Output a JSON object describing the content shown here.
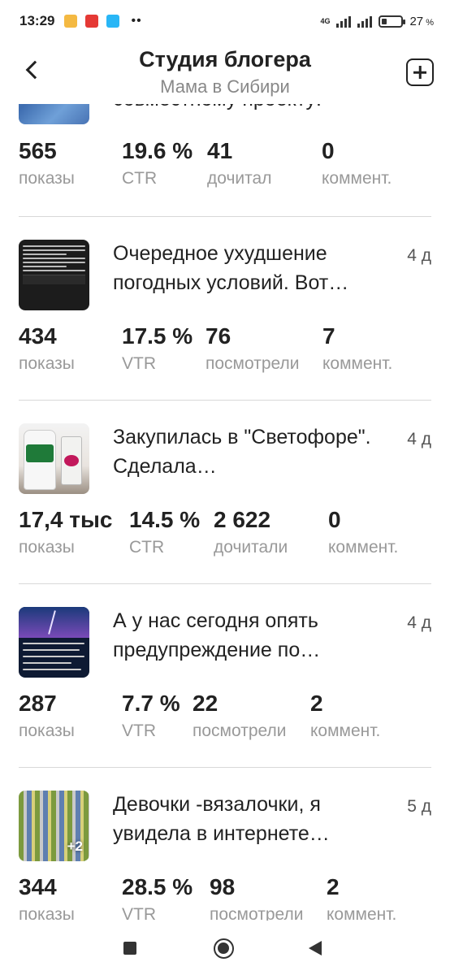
{
  "status_bar": {
    "time": "13:29",
    "network": "4G",
    "battery": "27"
  },
  "header": {
    "title": "Студия блогера",
    "subtitle": "Мама в Сибири"
  },
  "labels": {
    "views": "показы",
    "comments": "коммент."
  },
  "posts": [
    {
      "title": "совместному проекту!",
      "age": "",
      "views": "565",
      "rate": "19.6 %",
      "rate_label": "CTR",
      "reads": "41",
      "reads_label": "дочитал",
      "comments": "0"
    },
    {
      "title": "Очередное ухудшение погодных условий. Вот…",
      "age": "4 д",
      "views": "434",
      "rate": "17.5 %",
      "rate_label": "VTR",
      "reads": "76",
      "reads_label": "посмотрели",
      "comments": "7"
    },
    {
      "title": "Закупилась в \"Светофоре\". Сделала…",
      "age": "4 д",
      "views": "17,4 тыс",
      "rate": "14.5 %",
      "rate_label": "CTR",
      "reads": "2 622",
      "reads_label": "дочитали",
      "comments": "0"
    },
    {
      "title": "А у нас сегодня опять предупреждение по…",
      "age": "4 д",
      "views": "287",
      "rate": "7.7 %",
      "rate_label": "VTR",
      "reads": "22",
      "reads_label": "посмотрели",
      "comments": "2"
    },
    {
      "title": "Девочки -вязалочки, я увидела в интернете…",
      "age": "5 д",
      "views": "344",
      "rate": "28.5 %",
      "rate_label": "VTR",
      "reads": "98",
      "reads_label": "посмотрели",
      "comments": "2",
      "thumb_badge": "+2"
    }
  ]
}
